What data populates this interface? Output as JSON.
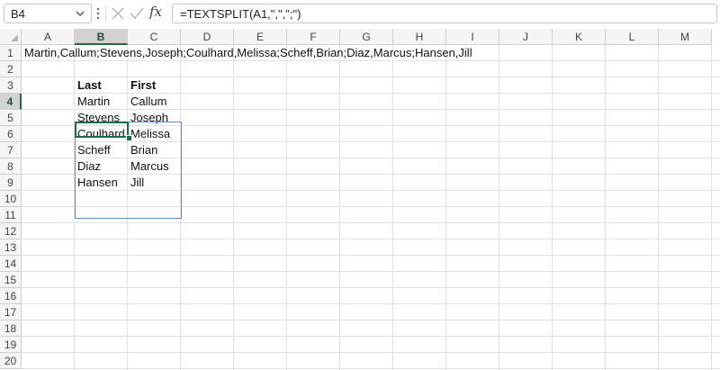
{
  "formula_bar": {
    "name_box": "B4",
    "fx_label": "fx",
    "formula": "=TEXTSPLIT(A1,\",\",\";\")"
  },
  "columns": [
    "A",
    "B",
    "C",
    "D",
    "E",
    "F",
    "G",
    "H",
    "I",
    "J",
    "K",
    "L",
    "M"
  ],
  "rows": [
    "1",
    "2",
    "3",
    "4",
    "5",
    "6",
    "7",
    "8",
    "9",
    "10",
    "11",
    "12",
    "13",
    "14",
    "15",
    "16",
    "17",
    "18",
    "19",
    "20"
  ],
  "selected": {
    "column": "B",
    "row": "4"
  },
  "cells": {
    "A1": "Martin,Callum;Stevens,Joseph;Coulhard,Melissa;Scheff,Brian;Diaz,Marcus;Hansen,Jill",
    "B3": "Last",
    "C3": "First",
    "B4": "Martin",
    "C4": "Callum",
    "B5": "Stevens",
    "C5": "Joseph",
    "B6": "Coulhard",
    "C6": "Melissa",
    "B7": "Scheff",
    "C7": "Brian",
    "B8": "Diaz",
    "C8": "Marcus",
    "B9": "Hansen",
    "C9": "Jill"
  },
  "colors": {
    "accent": "#1d6b40",
    "spill_border": "#5b8ed6"
  },
  "icons": [
    "chevron-down-icon",
    "more-dots-icon",
    "cancel-icon",
    "enter-check-icon",
    "function-icon"
  ]
}
